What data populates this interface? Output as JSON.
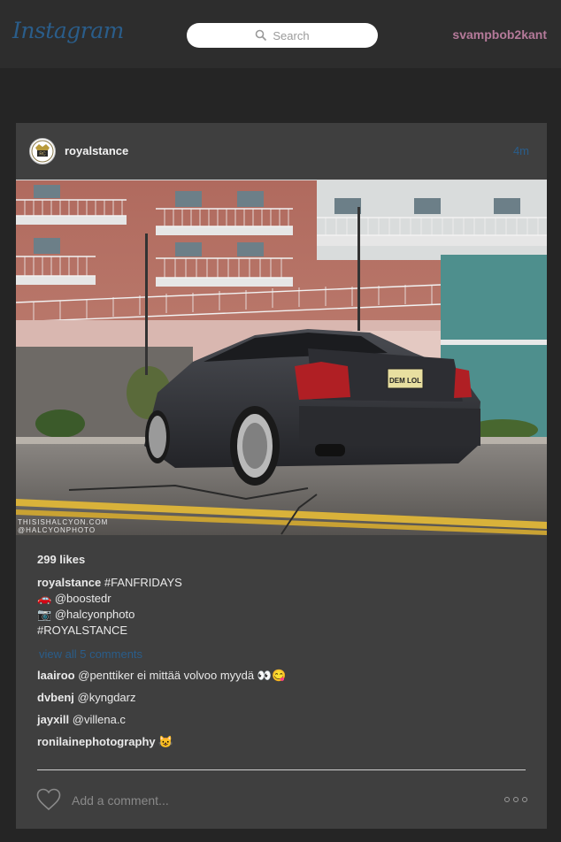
{
  "header": {
    "logo_text": "Instagram",
    "search_placeholder": "Search",
    "username": "svampbob2kant"
  },
  "post": {
    "author": "royalstance",
    "avatar_text": "RC",
    "time": "4m",
    "photo": {
      "plate_text": "DEM LOL",
      "watermark_line1": "THISISHALCYON.COM",
      "watermark_line2": "@HALCYONPHOTO"
    },
    "likes": "299 likes",
    "caption": {
      "author": "royalstance",
      "text": "#FANFRIDAYS",
      "line2_icon": "🚗",
      "line2": "@boostedr",
      "line3_icon": "📷",
      "line3": "@halcyonphoto",
      "line4": "#ROYALSTANCE"
    },
    "view_all": "view all 5 comments",
    "comments": [
      {
        "user": "laairoo",
        "text": "@penttiker ei mittää volvoo myydä 👀😋"
      },
      {
        "user": "dvbenj",
        "text": "@kyngdarz"
      },
      {
        "user": "jayxill",
        "text": "@villena.c"
      },
      {
        "user": "ronilainephotography",
        "text": "😺"
      }
    ],
    "add_comment_placeholder": "Add a comment..."
  },
  "colors": {
    "accent": "#2a5d8a",
    "username": "#b57a9a",
    "background": "#252525",
    "card": "#3f3f3f"
  }
}
